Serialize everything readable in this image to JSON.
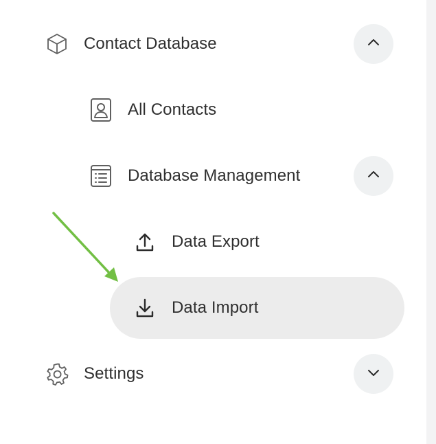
{
  "nav": {
    "contact_database": {
      "label": "Contact Database",
      "icon": "cube-icon",
      "expanded": true
    },
    "all_contacts": {
      "label": "All Contacts",
      "icon": "contact-card-icon"
    },
    "database_management": {
      "label": "Database Management",
      "icon": "list-icon",
      "expanded": true
    },
    "data_export": {
      "label": "Data Export",
      "icon": "upload-icon"
    },
    "data_import": {
      "label": "Data Import",
      "icon": "download-icon",
      "active": true
    },
    "settings": {
      "label": "Settings",
      "icon": "gear-icon",
      "expanded": false
    }
  },
  "colors": {
    "active_background": "#ececec",
    "toggle_background": "#eff1f2",
    "annotation_arrow": "#72bf44",
    "text": "#2f2f2f"
  }
}
